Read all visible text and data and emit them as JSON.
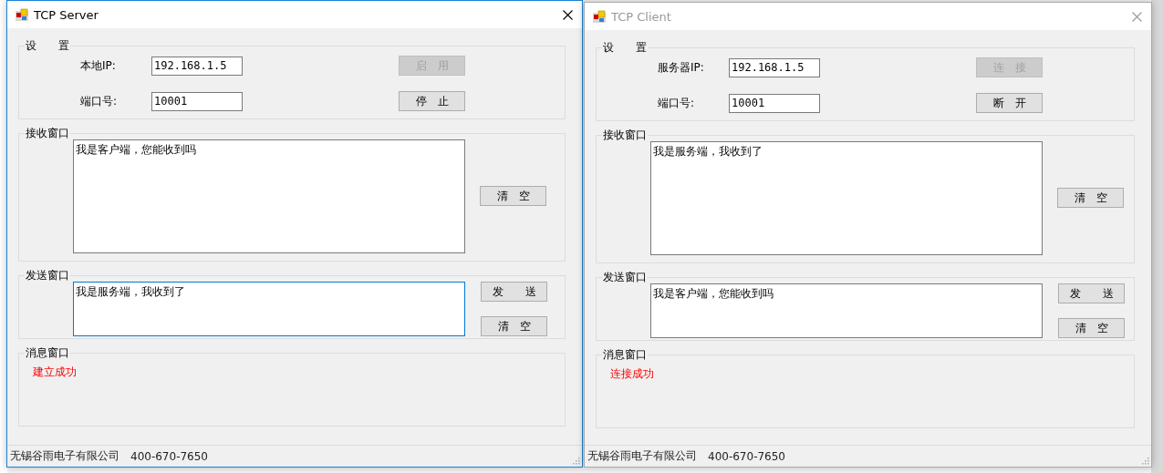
{
  "windows": [
    {
      "title": "TCP Server",
      "active": true,
      "settings": {
        "title": "设　　置",
        "fields": [
          {
            "label": "本地IP:",
            "value": "192.168.1.5"
          },
          {
            "label": "端口号:",
            "value": "10001"
          }
        ],
        "buttons": [
          {
            "label": "启　用",
            "disabled": true
          },
          {
            "label": "停　止",
            "disabled": false
          }
        ]
      },
      "receive": {
        "title": "接收窗口",
        "text": "我是客户端，您能收到吗",
        "buttons": [
          {
            "label": "清　空"
          }
        ]
      },
      "send": {
        "title": "发送窗口",
        "text": "我是服务端，我收到了",
        "focused": true,
        "buttons": [
          {
            "label": "发　　送"
          },
          {
            "label": "清　空"
          }
        ]
      },
      "message": {
        "title": "消息窗口",
        "text": "建立成功"
      },
      "status_bar": {
        "company": "无锡谷雨电子有限公司",
        "phone": "400-670-7650"
      }
    },
    {
      "title": "TCP Client",
      "active": false,
      "settings": {
        "title": "设　　置",
        "fields": [
          {
            "label": "服务器IP:",
            "value": "192.168.1.5"
          },
          {
            "label": "端口号:",
            "value": "10001"
          }
        ],
        "buttons": [
          {
            "label": "连　接",
            "disabled": true
          },
          {
            "label": "断　开",
            "disabled": false
          }
        ]
      },
      "receive": {
        "title": "接收窗口",
        "text": "我是服务端，我收到了",
        "buttons": [
          {
            "label": "清　空"
          }
        ]
      },
      "send": {
        "title": "发送窗口",
        "text": "我是客户端，您能收到吗",
        "focused": false,
        "buttons": [
          {
            "label": "发　　送"
          },
          {
            "label": "清　空"
          }
        ]
      },
      "message": {
        "title": "消息窗口",
        "text": "连接成功"
      },
      "status_bar": {
        "company": "无锡谷雨电子有限公司",
        "phone": "400-670-7650"
      }
    }
  ]
}
